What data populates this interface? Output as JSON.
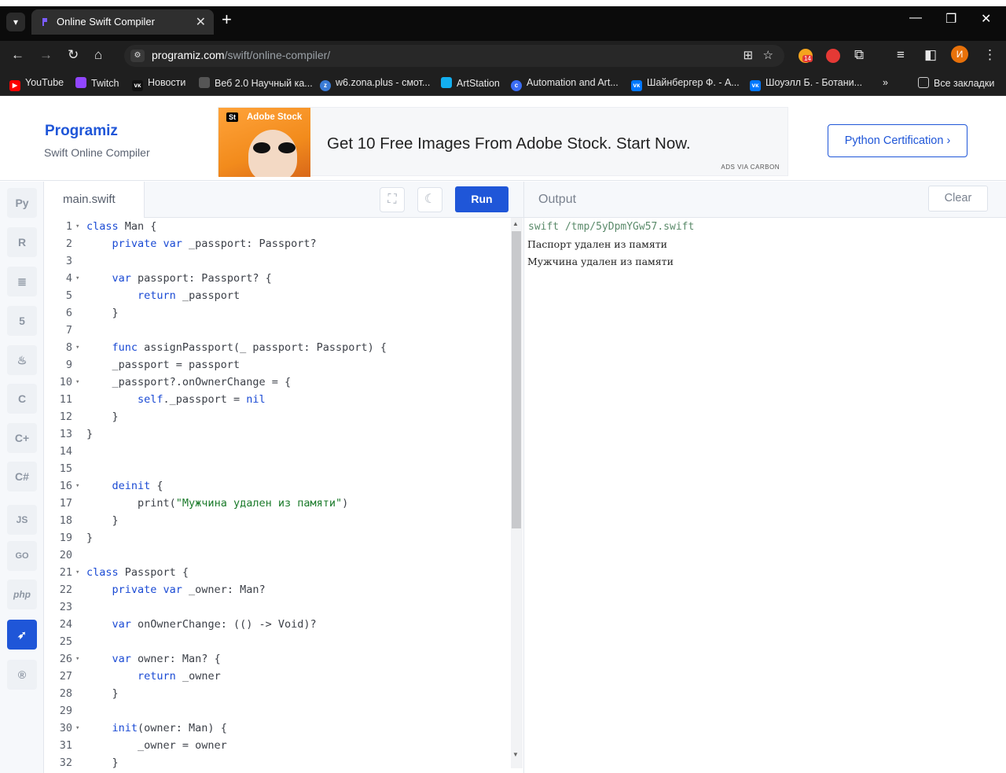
{
  "browser": {
    "tab_title": "Online Swift Compiler",
    "url_host": "programiz.com",
    "url_path": "/swift/online-compiler/",
    "profile_initial": "И",
    "extension_badge": "14",
    "bookmarks": [
      {
        "label": "YouTube",
        "color": "#ff0000"
      },
      {
        "label": "Twitch",
        "color": "#9146ff"
      },
      {
        "label": "Новости",
        "color": "#111111"
      },
      {
        "label": "Веб 2.0 Научный ка...",
        "color": "#555555"
      },
      {
        "label": "w6.zona.plus - смот...",
        "color": "#3a7bd5"
      },
      {
        "label": "ArtStation",
        "color": "#13aff0"
      },
      {
        "label": "Automation and Art...",
        "color": "#3a6cf4"
      },
      {
        "label": "Шайнбергер Ф. - А...",
        "color": "#0077ff"
      },
      {
        "label": "Шоуэлл Б. - Ботани...",
        "color": "#0077ff"
      }
    ],
    "all_bookmarks": "Все закладки"
  },
  "header": {
    "logo": "Programiz",
    "subtitle": "Swift Online Compiler",
    "ad_brand": "Adobe Stock",
    "ad_badge": "St",
    "ad_text": "Get 10 Free Images From Adobe Stock. Start Now.",
    "ad_via": "ADS VIA CARBON",
    "cert_button": "Python Certification ›"
  },
  "rail": {
    "items": [
      "python",
      "r",
      "sql",
      "html",
      "java",
      "c",
      "cpp",
      "csharp",
      "JS",
      "GO",
      "php",
      "swift",
      "rust"
    ]
  },
  "editor": {
    "file_name": "main.swift",
    "run_label": "Run",
    "lines": [
      {
        "n": "1",
        "fold": true,
        "code": "<span class=\"kw\">class</span> Man {"
      },
      {
        "n": "2",
        "fold": false,
        "code": "    <span class=\"kw\">private var</span> _passport: Passport?"
      },
      {
        "n": "3",
        "fold": false,
        "code": ""
      },
      {
        "n": "4",
        "fold": true,
        "code": "    <span class=\"kw\">var</span> passport: Passport? {"
      },
      {
        "n": "5",
        "fold": false,
        "code": "        <span class=\"kw\">return</span> _passport"
      },
      {
        "n": "6",
        "fold": false,
        "code": "    }"
      },
      {
        "n": "7",
        "fold": false,
        "code": ""
      },
      {
        "n": "8",
        "fold": true,
        "code": "    <span class=\"kw\">func</span> assignPassport(_ passport: Passport) {"
      },
      {
        "n": "9",
        "fold": false,
        "code": "    _passport = passport"
      },
      {
        "n": "10",
        "fold": true,
        "code": "    _passport?.onOwnerChange = {"
      },
      {
        "n": "11",
        "fold": false,
        "code": "        <span class=\"kw\">self</span>._passport = <span class=\"kw\">nil</span>"
      },
      {
        "n": "12",
        "fold": false,
        "code": "    }"
      },
      {
        "n": "13",
        "fold": false,
        "code": "}"
      },
      {
        "n": "14",
        "fold": false,
        "code": ""
      },
      {
        "n": "15",
        "fold": false,
        "code": ""
      },
      {
        "n": "16",
        "fold": true,
        "code": "    <span class=\"kw\">deinit</span> {"
      },
      {
        "n": "17",
        "fold": false,
        "code": "        print(<span class=\"str\">\"Мужчина удален из памяти\"</span>)"
      },
      {
        "n": "18",
        "fold": false,
        "code": "    }"
      },
      {
        "n": "19",
        "fold": false,
        "code": "}"
      },
      {
        "n": "20",
        "fold": false,
        "code": ""
      },
      {
        "n": "21",
        "fold": true,
        "code": "<span class=\"kw\">class</span> Passport {"
      },
      {
        "n": "22",
        "fold": false,
        "code": "    <span class=\"kw\">private var</span> _owner: Man?"
      },
      {
        "n": "23",
        "fold": false,
        "code": ""
      },
      {
        "n": "24",
        "fold": false,
        "code": "    <span class=\"kw\">var</span> onOwnerChange: (() -> Void)?"
      },
      {
        "n": "25",
        "fold": false,
        "code": ""
      },
      {
        "n": "26",
        "fold": true,
        "code": "    <span class=\"kw\">var</span> owner: Man? {"
      },
      {
        "n": "27",
        "fold": false,
        "code": "        <span class=\"kw\">return</span> _owner"
      },
      {
        "n": "28",
        "fold": false,
        "code": "    }"
      },
      {
        "n": "29",
        "fold": false,
        "code": ""
      },
      {
        "n": "30",
        "fold": true,
        "code": "    <span class=\"kw\">init</span>(owner: Man) {"
      },
      {
        "n": "31",
        "fold": false,
        "code": "        _owner = owner"
      },
      {
        "n": "32",
        "fold": false,
        "code": "    }"
      }
    ]
  },
  "output": {
    "title": "Output",
    "clear_label": "Clear",
    "command": "swift /tmp/5yDpmYGw57.swift",
    "lines": [
      "Паспорт удален из памяти",
      "Мужчина удален из памяти"
    ]
  }
}
